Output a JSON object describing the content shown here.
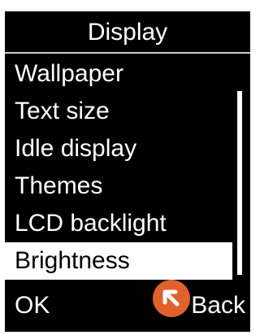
{
  "screen": {
    "title": "Display"
  },
  "menu": {
    "items": [
      {
        "label": "Wallpaper",
        "selected": false
      },
      {
        "label": "Text size",
        "selected": false
      },
      {
        "label": "Idle display",
        "selected": false
      },
      {
        "label": "Themes",
        "selected": false
      },
      {
        "label": "LCD backlight",
        "selected": false
      },
      {
        "label": "Brightness",
        "selected": true
      }
    ]
  },
  "softkeys": {
    "left_label": "OK",
    "right_label": "Back"
  },
  "cursor": {
    "icon": "arrow-up-left-icon",
    "badge_color": "#e2612a"
  },
  "colors": {
    "screen_background": "#000000",
    "text": "#ffffff",
    "highlight_background": "#ffffff",
    "highlight_text": "#000000"
  }
}
